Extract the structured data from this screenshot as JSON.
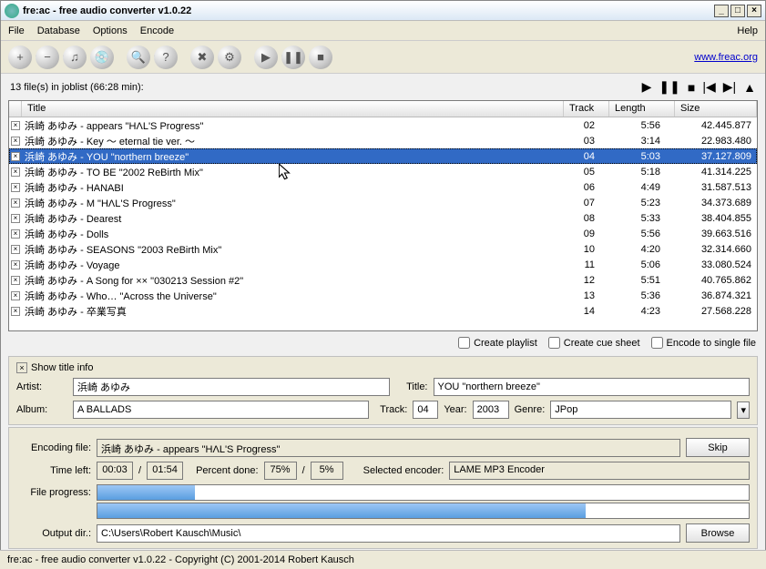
{
  "window": {
    "title": "fre:ac - free audio converter v1.0.22"
  },
  "menu": {
    "file": "File",
    "database": "Database",
    "options": "Options",
    "encode": "Encode",
    "help": "Help"
  },
  "url": "www.freac.org",
  "joblist_summary": "13 file(s) in joblist (66:28 min):",
  "headers": {
    "title": "Title",
    "track": "Track",
    "length": "Length",
    "size": "Size"
  },
  "tracks": [
    {
      "title": "浜崎 あゆみ - appears \"HΛL'S Progress\"",
      "track": "02",
      "length": "5:56",
      "size": "42.445.877"
    },
    {
      "title": "浜崎 あゆみ - Key ～ eternal tie ver. ～",
      "track": "03",
      "length": "3:14",
      "size": "22.983.480"
    },
    {
      "title": "浜崎 あゆみ - YOU \"northern breeze\"",
      "track": "04",
      "length": "5:03",
      "size": "37.127.809"
    },
    {
      "title": "浜崎 あゆみ - TO BE \"2002 ReBirth Mix\"",
      "track": "05",
      "length": "5:18",
      "size": "41.314.225"
    },
    {
      "title": "浜崎 あゆみ - HANABI",
      "track": "06",
      "length": "4:49",
      "size": "31.587.513"
    },
    {
      "title": "浜崎 あゆみ - M \"HΛL'S Progress\"",
      "track": "07",
      "length": "5:23",
      "size": "34.373.689"
    },
    {
      "title": "浜崎 あゆみ - Dearest",
      "track": "08",
      "length": "5:33",
      "size": "38.404.855"
    },
    {
      "title": "浜崎 あゆみ - Dolls",
      "track": "09",
      "length": "5:56",
      "size": "39.663.516"
    },
    {
      "title": "浜崎 あゆみ - SEASONS \"2003 ReBirth Mix\"",
      "track": "10",
      "length": "4:20",
      "size": "32.314.660"
    },
    {
      "title": "浜崎 あゆみ - Voyage",
      "track": "11",
      "length": "5:06",
      "size": "33.080.524"
    },
    {
      "title": "浜崎 あゆみ - A Song for ×× \"030213 Session #2\"",
      "track": "12",
      "length": "5:51",
      "size": "40.765.862"
    },
    {
      "title": "浜崎 あゆみ - Who… \"Across the Universe\"",
      "track": "13",
      "length": "5:36",
      "size": "36.874.321"
    },
    {
      "title": "浜崎 あゆみ - 卒業写真",
      "track": "14",
      "length": "4:23",
      "size": "27.568.228"
    }
  ],
  "selected_index": 2,
  "options": {
    "playlist": "Create playlist",
    "cuesheet": "Create cue sheet",
    "singlefile": "Encode to single file"
  },
  "titleinfo": {
    "header": "Show title info",
    "artist_lbl": "Artist:",
    "artist": "浜崎 あゆみ",
    "album_lbl": "Album:",
    "album": "A BALLADS",
    "title_lbl": "Title:",
    "title": "YOU \"northern breeze\"",
    "track_lbl": "Track:",
    "track": "04",
    "year_lbl": "Year:",
    "year": "2003",
    "genre_lbl": "Genre:",
    "genre": "JPop"
  },
  "encoding": {
    "file_lbl": "Encoding file:",
    "file": "浜崎 あゆみ - appears \"HΛL'S Progress\"",
    "skip": "Skip",
    "timeleft_lbl": "Time left:",
    "time_elapsed": "00:03",
    "time_total": "01:54",
    "percent_lbl": "Percent done:",
    "pct_file": "75%",
    "pct_total": "5%",
    "selenc_lbl": "Selected encoder:",
    "encoder": "LAME MP3 Encoder",
    "fileprog_lbl": "File progress:",
    "outdir_lbl": "Output dir.:",
    "outdir": "C:\\Users\\Robert Kausch\\Music\\",
    "browse": "Browse",
    "progress_file_pct": 15,
    "progress_total_pct": 75
  },
  "statusbar": "fre:ac - free audio converter v1.0.22 - Copyright (C) 2001-2014 Robert Kausch"
}
